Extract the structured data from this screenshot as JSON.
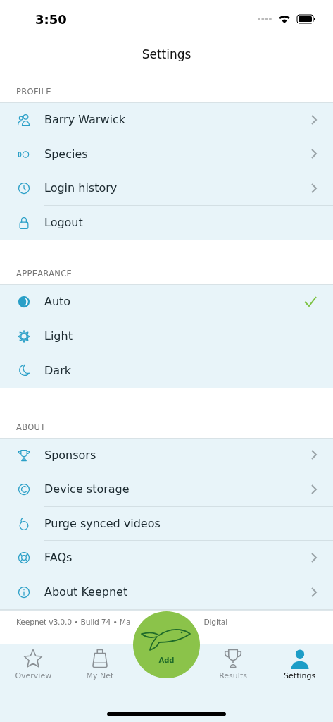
{
  "status_bar": {
    "time": "3:50"
  },
  "title": "Settings",
  "sections": [
    {
      "header": "PROFILE",
      "items": [
        {
          "label": "Barry Warwick",
          "chevron": true
        },
        {
          "label": "Species",
          "chevron": true
        },
        {
          "label": "Login history",
          "chevron": true
        },
        {
          "label": "Logout",
          "chevron": false
        }
      ]
    },
    {
      "header": "APPEARANCE",
      "items": [
        {
          "label": "Auto",
          "chevron": false,
          "selected": true
        },
        {
          "label": "Light",
          "chevron": false,
          "selected": false
        },
        {
          "label": "Dark",
          "chevron": false,
          "selected": false
        }
      ]
    },
    {
      "header": "ABOUT",
      "items": [
        {
          "label": "Sponsors",
          "chevron": true
        },
        {
          "label": "Device storage",
          "chevron": true
        },
        {
          "label": "Purge synced videos",
          "chevron": false
        },
        {
          "label": "FAQs",
          "chevron": true
        },
        {
          "label": "About Keepnet",
          "chevron": true
        }
      ]
    }
  ],
  "footer": {
    "text_start": "Keepnet v3.0.0 • Build 74 • Ma",
    "text_end": "Digital"
  },
  "tab_bar": [
    {
      "label": "Overview",
      "selected": false
    },
    {
      "label": "My Net",
      "selected": false
    },
    {
      "label": "Add",
      "selected": false,
      "kind": "add"
    },
    {
      "label": "Results",
      "selected": false
    },
    {
      "label": "Settings",
      "selected": true
    }
  ]
}
